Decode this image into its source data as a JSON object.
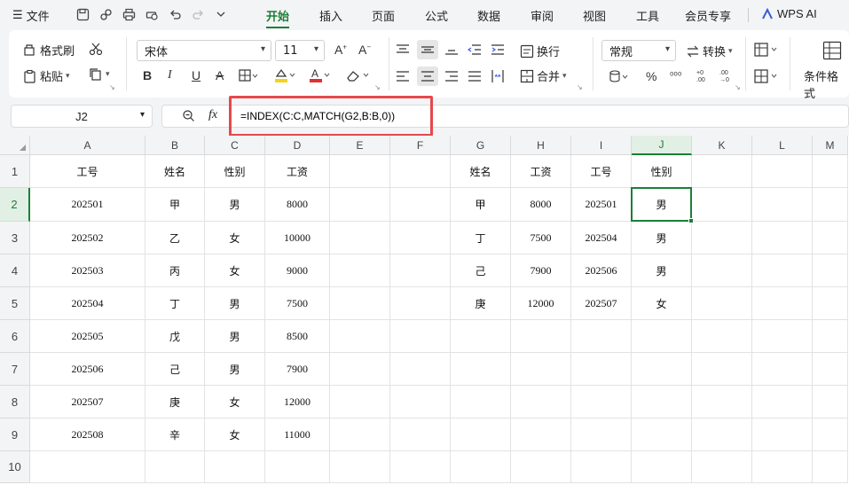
{
  "menubar": {
    "hamburger": "☰",
    "file_label": "文件",
    "tabs": [
      "开始",
      "插入",
      "页面",
      "公式",
      "数据",
      "审阅",
      "视图",
      "工具",
      "会员专享",
      "WPS AI"
    ],
    "active_tab": "开始"
  },
  "ribbon": {
    "format_painter": "格式刷",
    "paste": "粘贴",
    "font_name": "宋体",
    "font_size": "11",
    "wrap": "换行",
    "merge": "合并",
    "number_format": "常规",
    "convert": "转换",
    "cond_format": "条件格式"
  },
  "formula_bar": {
    "name_box": "J2",
    "fx_label": "fx",
    "formula": "=INDEX(C:C,MATCH(G2,B:B,0))"
  },
  "sheet": {
    "columns": [
      "A",
      "B",
      "C",
      "D",
      "E",
      "F",
      "G",
      "H",
      "I",
      "J",
      "K",
      "L",
      "M"
    ],
    "rows": [
      "1",
      "2",
      "3",
      "4",
      "5",
      "6",
      "7",
      "8",
      "9",
      "10"
    ],
    "selected_column": "J",
    "selected_row": "2",
    "cells": {
      "A1": "工号",
      "B1": "姓名",
      "C1": "性别",
      "D1": "工资",
      "A2": "202501",
      "B2": "甲",
      "C2": "男",
      "D2": "8000",
      "A3": "202502",
      "B3": "乙",
      "C3": "女",
      "D3": "10000",
      "A4": "202503",
      "B4": "丙",
      "C4": "女",
      "D4": "9000",
      "A5": "202504",
      "B5": "丁",
      "C5": "男",
      "D5": "7500",
      "A6": "202505",
      "B6": "戊",
      "C6": "男",
      "D6": "8500",
      "A7": "202506",
      "B7": "己",
      "C7": "男",
      "D7": "7900",
      "A8": "202507",
      "B8": "庚",
      "C8": "女",
      "D8": "12000",
      "A9": "202508",
      "B9": "辛",
      "C9": "女",
      "D9": "11000",
      "G1": "姓名",
      "H1": "工资",
      "I1": "工号",
      "J1": "性别",
      "G2": "甲",
      "H2": "8000",
      "I2": "202501",
      "J2": "男",
      "G3": "丁",
      "H3": "7500",
      "I3": "202504",
      "J3": "男",
      "G4": "己",
      "H4": "7900",
      "I4": "202506",
      "J4": "男",
      "G5": "庚",
      "H5": "12000",
      "I5": "202507",
      "J5": "女"
    }
  },
  "colors": {
    "accent": "#1a7f37",
    "highlight_box": "#e5484d"
  }
}
